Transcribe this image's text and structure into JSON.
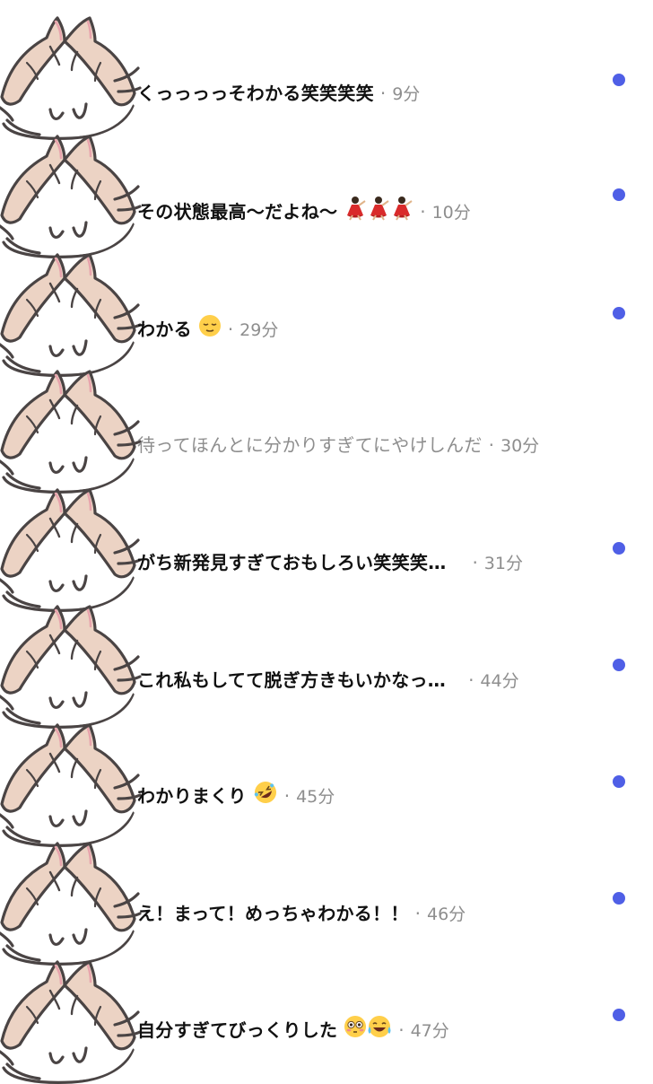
{
  "accent_color": "#4f5fe6",
  "separator": "·",
  "comments": [
    {
      "text": "くっっっっそわかる笑笑笑笑",
      "emojis": [],
      "time": "9分",
      "unread": true
    },
    {
      "text": "その状態最高〜だよね〜",
      "emojis": [
        "dancer-icon",
        "dancer-icon",
        "dancer-icon"
      ],
      "time": "10分",
      "unread": true
    },
    {
      "text": "わかる",
      "emojis": [
        "relieved-face-icon"
      ],
      "time": "29分",
      "unread": true
    },
    {
      "text": "待ってほんとに分かりすぎてにやけしんだ",
      "emojis": [],
      "time": "30分",
      "unread": false
    },
    {
      "text": "がち新発見すぎておもしろい笑笑笑…",
      "emojis": [],
      "time": "31分",
      "unread": true
    },
    {
      "text": "これ私もしてて脱ぎ方きもいかなっ…",
      "emojis": [],
      "time": "44分",
      "unread": true
    },
    {
      "text": "わかりまくり",
      "emojis": [
        "rofl-face-icon"
      ],
      "time": "45分",
      "unread": true
    },
    {
      "text": "え！まって！めっちゃわかる！！",
      "emojis": [],
      "time": "46分",
      "unread": true
    },
    {
      "text": "自分すぎてびっくりした",
      "emojis": [
        "flushed-face-icon",
        "joy-face-icon"
      ],
      "time": "47分",
      "unread": true
    }
  ]
}
